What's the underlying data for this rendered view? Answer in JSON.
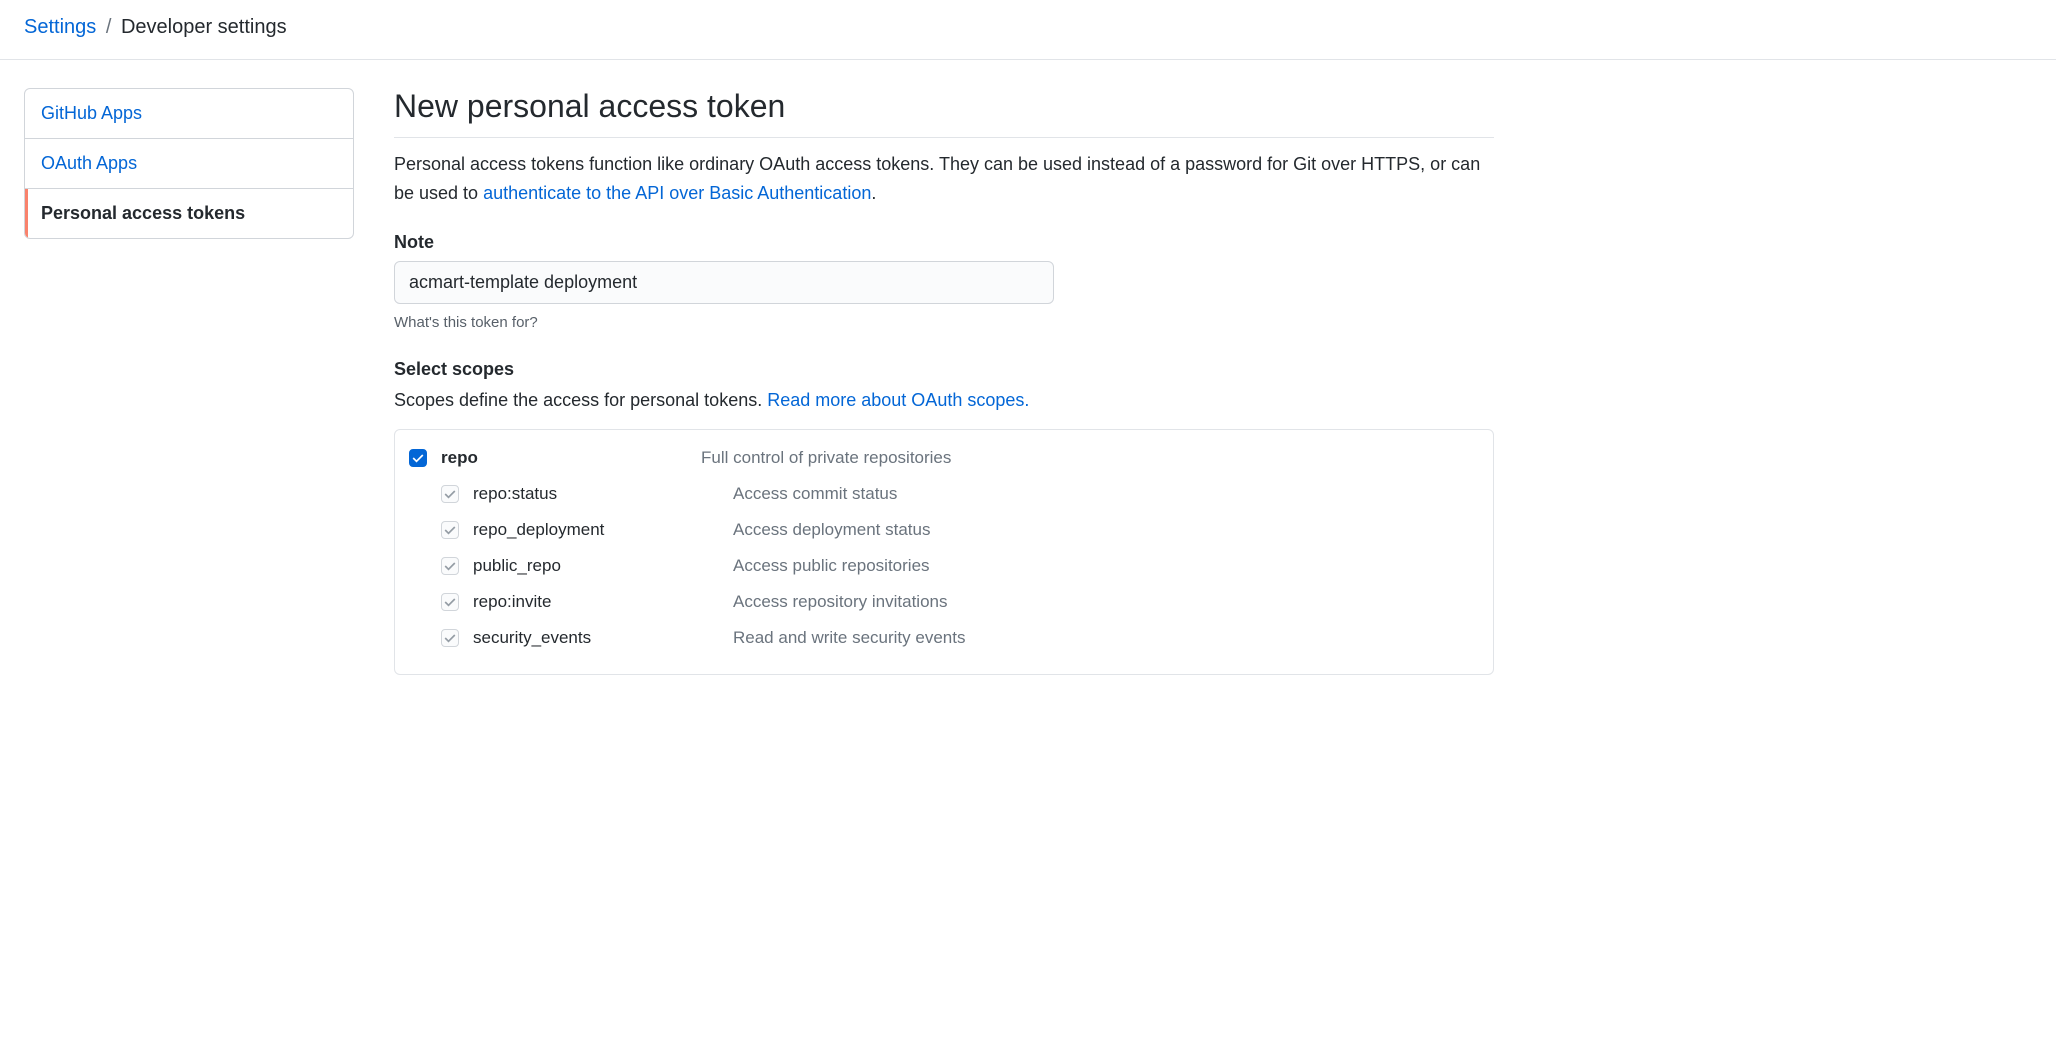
{
  "breadcrumb": {
    "parent": "Settings",
    "current": "Developer settings"
  },
  "sidebar": {
    "items": [
      {
        "label": "GitHub Apps",
        "active": false
      },
      {
        "label": "OAuth Apps",
        "active": false
      },
      {
        "label": "Personal access tokens",
        "active": true
      }
    ]
  },
  "main": {
    "title": "New personal access token",
    "description_text_a": "Personal access tokens function like ordinary OAuth access tokens. They can be used instead of a password for Git over HTTPS, or can be used to ",
    "description_link": "authenticate to the API over Basic Authentication",
    "description_text_b": ".",
    "note": {
      "label": "Note",
      "value": "acmart-template deployment",
      "help": "What's this token for?"
    },
    "scopes": {
      "title": "Select scopes",
      "desc_text": "Scopes define the access for personal tokens. ",
      "desc_link": "Read more about OAuth scopes.",
      "groups": [
        {
          "name": "repo",
          "desc": "Full control of private repositories",
          "checked": true,
          "children": [
            {
              "name": "repo:status",
              "desc": "Access commit status"
            },
            {
              "name": "repo_deployment",
              "desc": "Access deployment status"
            },
            {
              "name": "public_repo",
              "desc": "Access public repositories"
            },
            {
              "name": "repo:invite",
              "desc": "Access repository invitations"
            },
            {
              "name": "security_events",
              "desc": "Read and write security events"
            }
          ]
        }
      ]
    }
  }
}
